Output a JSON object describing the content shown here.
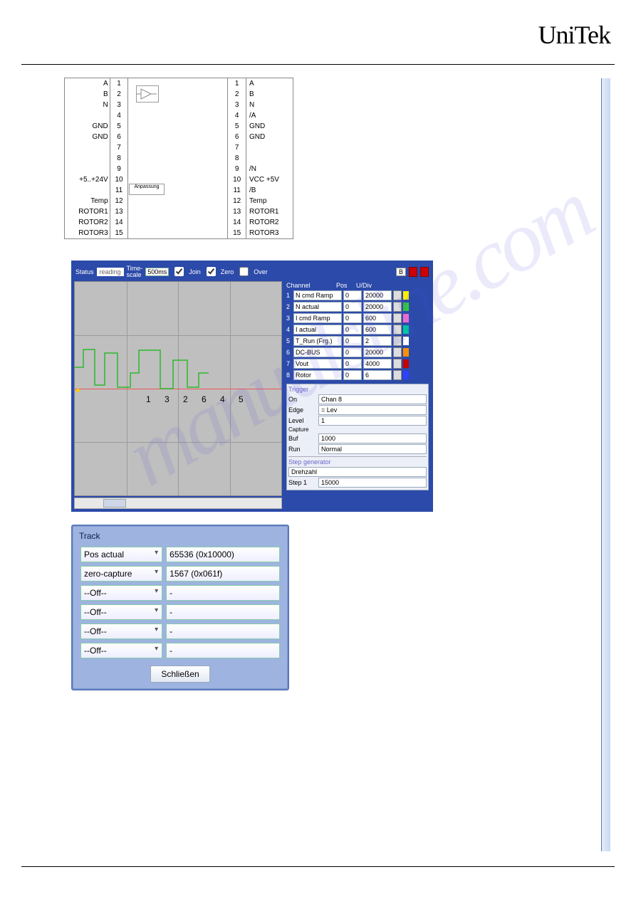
{
  "brand": "UniTek",
  "watermark_text": "manualsline.com",
  "diagram": {
    "left_labels": [
      "A",
      "B",
      "N",
      "",
      "GND",
      "GND",
      "",
      "",
      "",
      "+5..+24V",
      "",
      "Temp",
      "ROTOR1",
      "ROTOR2",
      "ROTOR3"
    ],
    "left_nums": [
      "1",
      "2",
      "3",
      "4",
      "5",
      "6",
      "7",
      "8",
      "9",
      "10",
      "11",
      "12",
      "13",
      "14",
      "15"
    ],
    "right_nums": [
      "1",
      "2",
      "3",
      "4",
      "5",
      "6",
      "7",
      "8",
      "9",
      "10",
      "11",
      "12",
      "13",
      "14",
      "15"
    ],
    "right_labels": [
      "A",
      "B",
      "N",
      "/A",
      "GND",
      "GND",
      "",
      "",
      "/N",
      "VCC +5V",
      "/B",
      "Temp",
      "ROTOR1",
      "ROTOR2",
      "ROTOR3"
    ],
    "anpassung": "Anpassung"
  },
  "scope": {
    "status_label": "Status",
    "status_value": "reading",
    "timescale_label": "Time-\nscale",
    "timescale_value": "500ms",
    "join_label": "Join",
    "zero_label": "Zero",
    "over_label": "Over",
    "plot_numbers": "1  3  2    6  4  5",
    "channel_header": {
      "c": "Channel",
      "p": "Pos",
      "u": "U/Div"
    },
    "channels": [
      {
        "n": "1",
        "name": "N cmd Ramp",
        "pos": "0",
        "udiv": "20000",
        "color": "#ffee00"
      },
      {
        "n": "2",
        "name": "N actual",
        "pos": "0",
        "udiv": "20000",
        "color": "#32cd32"
      },
      {
        "n": "3",
        "name": "I cmd Ramp",
        "pos": "0",
        "udiv": "600",
        "color": "#ff6fcf"
      },
      {
        "n": "4",
        "name": "I actual",
        "pos": "0",
        "udiv": "600",
        "color": "#00c8a0"
      },
      {
        "n": "5",
        "name": "T_Run (Frg.)",
        "pos": "0",
        "udiv": "2",
        "color": "#ffffff"
      },
      {
        "n": "6",
        "name": "DC-BUS",
        "pos": "0",
        "udiv": "20000",
        "color": "#ff9000"
      },
      {
        "n": "7",
        "name": "Vout",
        "pos": "0",
        "udiv": "4000",
        "color": "#c70000"
      },
      {
        "n": "8",
        "name": "Rotor",
        "pos": "0",
        "udiv": "6",
        "color": "#3040ff"
      }
    ],
    "trigger": {
      "title": "Trigger",
      "on_label": "On",
      "on_value": "Chan 8",
      "edge_label": "Edge",
      "edge_value": "= Lev",
      "level_label": "Level",
      "level_value": "1",
      "capture_label": "Capture",
      "buf_label": "Buf",
      "buf_value": "1000",
      "run_label": "Run",
      "run_value": "Normal"
    },
    "stepgen": {
      "title": "Step generator",
      "mode": "Drehzahl",
      "step1_label": "Step 1",
      "step1_value": "15000"
    }
  },
  "track": {
    "title": "Track",
    "rows": [
      {
        "select": "Pos actual",
        "value": "65536 (0x10000)"
      },
      {
        "select": "zero-capture",
        "value": "1567 (0x061f)"
      },
      {
        "select": "--Off--",
        "value": "-"
      },
      {
        "select": "--Off--",
        "value": "-"
      },
      {
        "select": "--Off--",
        "value": "-"
      },
      {
        "select": "--Off--",
        "value": "-"
      }
    ],
    "close_button": "Schließen"
  }
}
